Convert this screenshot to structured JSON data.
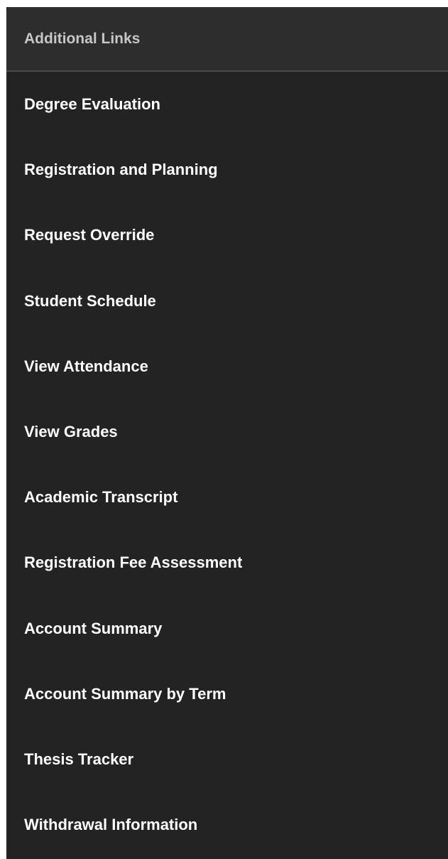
{
  "panel": {
    "header_title": "Additional Links",
    "links": [
      {
        "label": "Degree Evaluation"
      },
      {
        "label": "Registration and Planning"
      },
      {
        "label": "Request Override"
      },
      {
        "label": "Student Schedule"
      },
      {
        "label": "View Attendance"
      },
      {
        "label": "View Grades"
      },
      {
        "label": "Academic Transcript"
      },
      {
        "label": "Registration Fee Assessment"
      },
      {
        "label": "Account Summary"
      },
      {
        "label": "Account Summary by Term"
      },
      {
        "label": "Thesis Tracker"
      },
      {
        "label": "Withdrawal Information"
      }
    ]
  },
  "colors": {
    "panel_background": "#232323",
    "header_background": "#2d2d2d",
    "header_text": "#c7c7c7",
    "link_text": "#ffffff"
  }
}
